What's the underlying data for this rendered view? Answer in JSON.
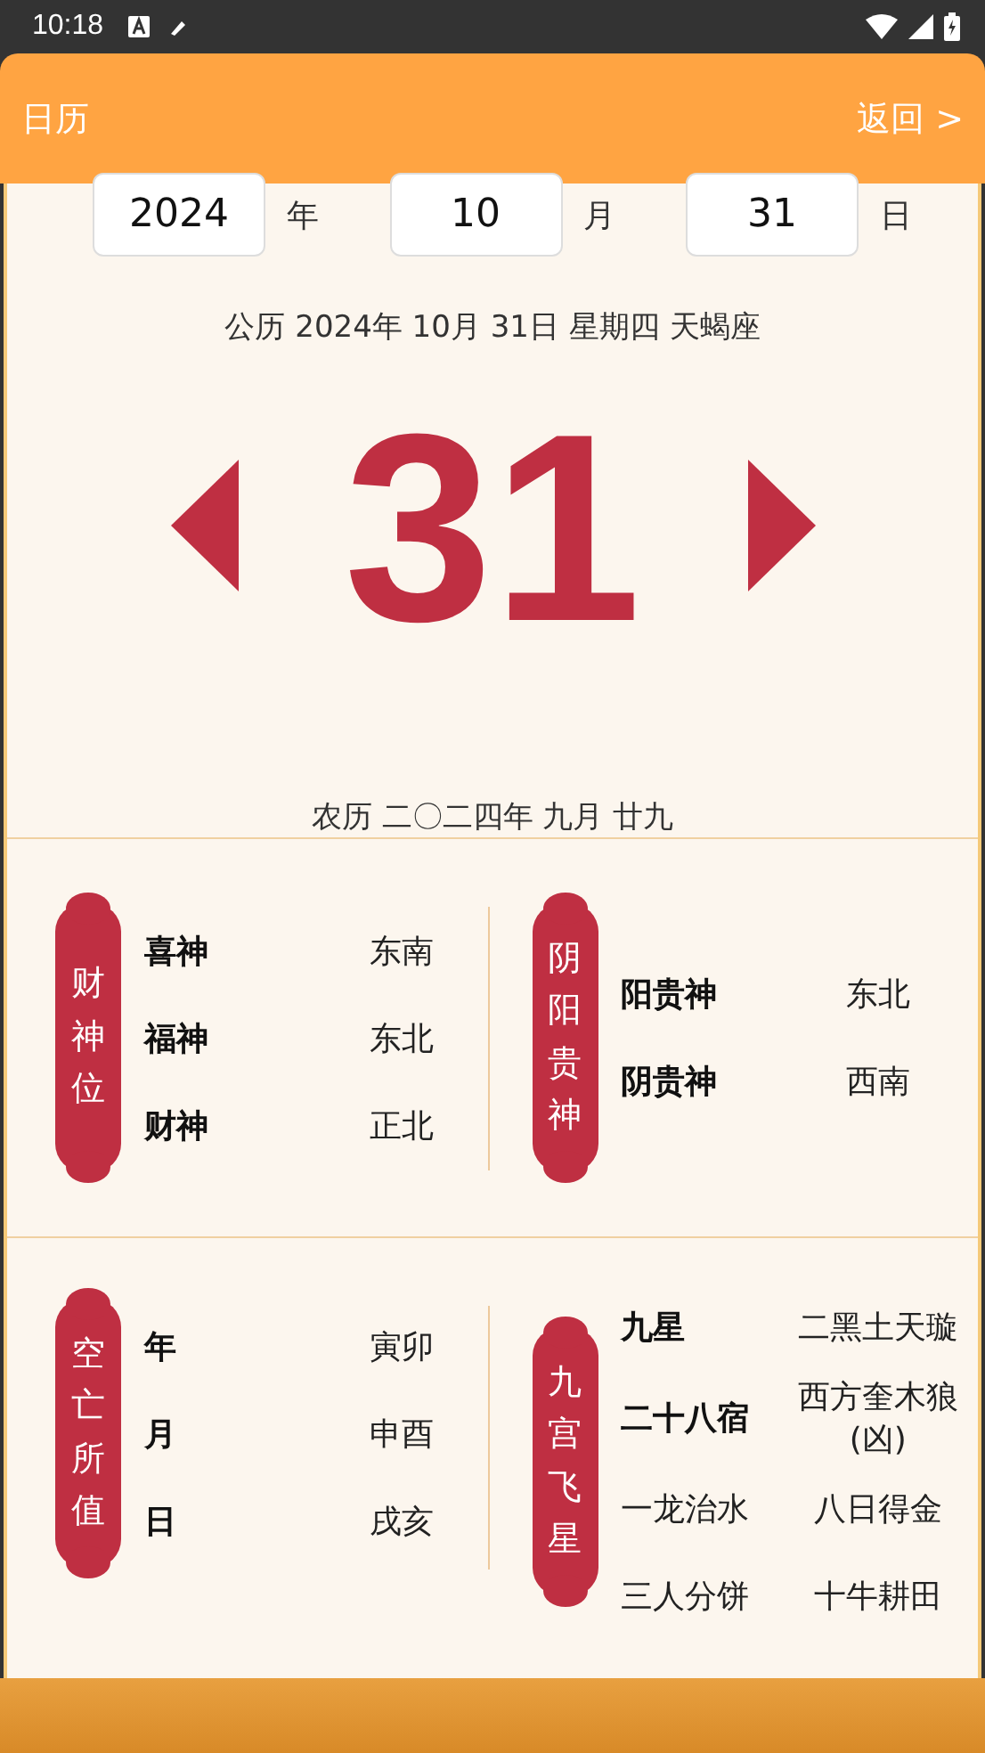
{
  "status_bar": {
    "time": "10:18"
  },
  "header": {
    "title": "日历",
    "back": "返回 >"
  },
  "date_fields": [
    {
      "value": "2024",
      "unit": "年"
    },
    {
      "value": "10",
      "unit": "月"
    },
    {
      "value": "31",
      "unit": "日"
    }
  ],
  "solar_line": "公历 2024年 10月 31日 星期四 天蝎座",
  "day": "31",
  "lunar_line": "农历 二〇二四年 九月 廿九",
  "sections": [
    {
      "panels": [
        {
          "label": "财神位",
          "rows": [
            {
              "kind": "term",
              "name": "喜神",
              "value": "东南"
            },
            {
              "kind": "term",
              "name": "福神",
              "value": "东北"
            },
            {
              "kind": "term",
              "name": "财神",
              "value": "正北"
            }
          ]
        },
        {
          "label": "阴阳贵神",
          "rows": [
            {
              "kind": "term",
              "name": "阳贵神",
              "value": "东北"
            },
            {
              "kind": "term",
              "name": "阴贵神",
              "value": "西南"
            }
          ]
        }
      ]
    },
    {
      "panels": [
        {
          "label": "空亡所值",
          "rows": [
            {
              "kind": "term",
              "name": "年",
              "value": "寅卯"
            },
            {
              "kind": "term",
              "name": "月",
              "value": "申酉"
            },
            {
              "kind": "term",
              "name": "日",
              "value": "戌亥"
            }
          ]
        },
        {
          "label": "九宫飞星",
          "rows": [
            {
              "kind": "term",
              "name": "九星",
              "value": "二黑土天璇"
            },
            {
              "kind": "term",
              "name": "二十八宿",
              "value": "西方奎木狼(凶)"
            },
            {
              "kind": "plain",
              "name": "一龙治水",
              "value": "八日得金"
            },
            {
              "kind": "plain",
              "name": "三人分饼",
              "value": "十牛耕田"
            }
          ]
        }
      ]
    }
  ]
}
